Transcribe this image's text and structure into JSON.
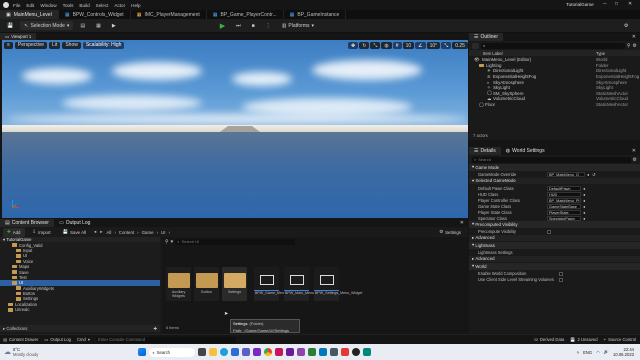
{
  "title": {
    "window": "TutorialGame"
  },
  "menu": [
    "File",
    "Edit",
    "Window",
    "Tools",
    "Build",
    "Select",
    "Actor",
    "Help"
  ],
  "doc_tabs": [
    "MainMenu_Level",
    "BPW_Controls_Widget",
    "IMC_PlayerManagement",
    "BP_Game_PlayerContr...",
    "BP_GameInstance"
  ],
  "toolbar": {
    "mode": "Selection Mode",
    "platforms": "Platforms"
  },
  "viewport": {
    "tab": "Viewport 1",
    "perspective": "Perspective",
    "lit": "Lit",
    "show": "Show",
    "scalability": "Scalability: High"
  },
  "outliner": {
    "title": "Outliner",
    "col_label": "Item Label",
    "col_type": "Type",
    "rows": [
      {
        "label": "MainMenu_Level (Editor)",
        "type": "World"
      },
      {
        "label": "Lighting",
        "type": "Folder"
      },
      {
        "label": "DirectionalLight",
        "type": "DirectionalLight"
      },
      {
        "label": "ExponentialHeightFog",
        "type": "ExponentialHeightFog"
      },
      {
        "label": "SkyAtmosphere",
        "type": "SkyAtmosphere"
      },
      {
        "label": "SkyLight",
        "type": "SkyLight"
      },
      {
        "label": "SM_SkySphere",
        "type": "StaticMeshActor"
      },
      {
        "label": "VolumetricCloud",
        "type": "VolumetricCloud"
      },
      {
        "label": "Floor",
        "type": "StaticMeshActor"
      }
    ],
    "count": "7 actors"
  },
  "details": {
    "tab_details": "Details",
    "tab_world": "World Settings",
    "search": "Search",
    "sec_game_mode": "Game Mode",
    "override_label": "GameMode Override",
    "override_value": "BP_MainMenu_G",
    "sec_selected": "Selected GameMode",
    "rows": [
      {
        "k": "Default Pawn Class",
        "v": "DefaultPawn"
      },
      {
        "k": "HUD Class",
        "v": "HUD"
      },
      {
        "k": "Player Controller Class",
        "v": "BP_MainMenu_Pl"
      },
      {
        "k": "Game State Class",
        "v": "GameStateBase"
      },
      {
        "k": "Player State Class",
        "v": "PlayerState"
      },
      {
        "k": "Spectator Class",
        "v": "SpectatorPawn"
      }
    ],
    "sec_precomp": "Precomputed Visibility",
    "precomp_row": "Precompute Visibility",
    "sec_advanced": "Advanced",
    "sec_lightmass": "Lightmass",
    "lightmass_row": "Lightmass Settings",
    "sec_advanced2": "Advanced",
    "sec_world": "World",
    "world_rows": [
      "Enable World Composition",
      "Use Client Side Level Streaming Volumes"
    ]
  },
  "content_browser": {
    "tab": "Content Browser",
    "tab_log": "Output Log",
    "add": "Add",
    "import": "Import",
    "save_all": "Save All",
    "breadcrumb": [
      "All",
      "Content",
      "Game",
      "UI"
    ],
    "settings": "Settings",
    "search_placeholder": "Search UI",
    "tree_root": "TutorialGame",
    "tree": [
      "Config_Valid",
      "Input",
      "UI",
      "Voice",
      "Maps",
      "Save",
      "Test",
      "UI",
      "AuxiliaryWidgets",
      "Button",
      "Settings",
      "Localization",
      "Unrealc"
    ],
    "tiles": [
      "Auxiliary Widgets",
      "Button",
      "Settings",
      "BPW_Game_Menu_Widget",
      "BPW_Main_Menu_Widget",
      "BPW_Settings_Menu_Widget"
    ],
    "tooltip_title": "Settings",
    "tooltip_kind": "(Folder)",
    "tooltip_path_label": "Path:",
    "tooltip_path": "/Game/Game/UI/Settings",
    "items_count": "6 items",
    "collections": "Collections"
  },
  "status": {
    "drawer": "Content Drawer",
    "log": "Output Log",
    "cmd": "Cmd",
    "cmd_placeholder": "Enter Console Command",
    "derived": "Derived Data",
    "unsaved": "2 Unsaved",
    "source": "Source Control"
  },
  "taskbar": {
    "weather_temp": "8°C",
    "weather_desc": "Mostly cloudy",
    "search": "Search",
    "lang": "ENG",
    "time": "22:44",
    "date": "10.06.2023"
  },
  "colors": {
    "accent": "#2a5ea8",
    "selection": "#2d5fa3",
    "folder": "#c49a52",
    "play": "#3cb043"
  }
}
